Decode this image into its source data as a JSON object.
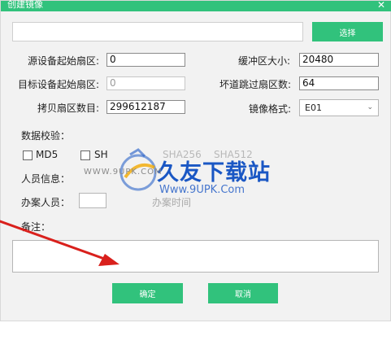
{
  "window": {
    "title": "创建镜像",
    "close_glyph": "✕"
  },
  "path": {
    "value": "",
    "browse_label": "选择"
  },
  "left_fields": [
    {
      "label": "源设备起始扇区:",
      "value": "0",
      "disabled": false
    },
    {
      "label": "目标设备起始扇区:",
      "value": "0",
      "disabled": true
    },
    {
      "label": "拷贝扇区数目:",
      "value": "299612187",
      "disabled": false
    }
  ],
  "right_fields": [
    {
      "label": "缓冲区大小:",
      "value": "20480"
    },
    {
      "label": "坏道跳过扇区数:",
      "value": "64"
    }
  ],
  "image_format": {
    "label": "镜像格式:",
    "value": "E01"
  },
  "checksum": {
    "label": "数据校验：",
    "options": [
      "MD5",
      "SH",
      "SHA256",
      "SHA512"
    ]
  },
  "person_info": {
    "label": "人员信息："
  },
  "case_officer": {
    "label": "办案人员：",
    "value": ""
  },
  "case_time": {
    "label": "办案时间"
  },
  "remarks": {
    "label": "备注：",
    "value": ""
  },
  "footer": {
    "ok_label": "确定",
    "cancel_label": "取消"
  },
  "watermark": {
    "brand": "久友下载站",
    "url_left": "WWW.9UPK.COM",
    "url_right": "Www.9UPK.Com"
  },
  "colors": {
    "accent": "#31c27c",
    "arrow": "#d9201c",
    "watermark": "#1a57c4"
  }
}
